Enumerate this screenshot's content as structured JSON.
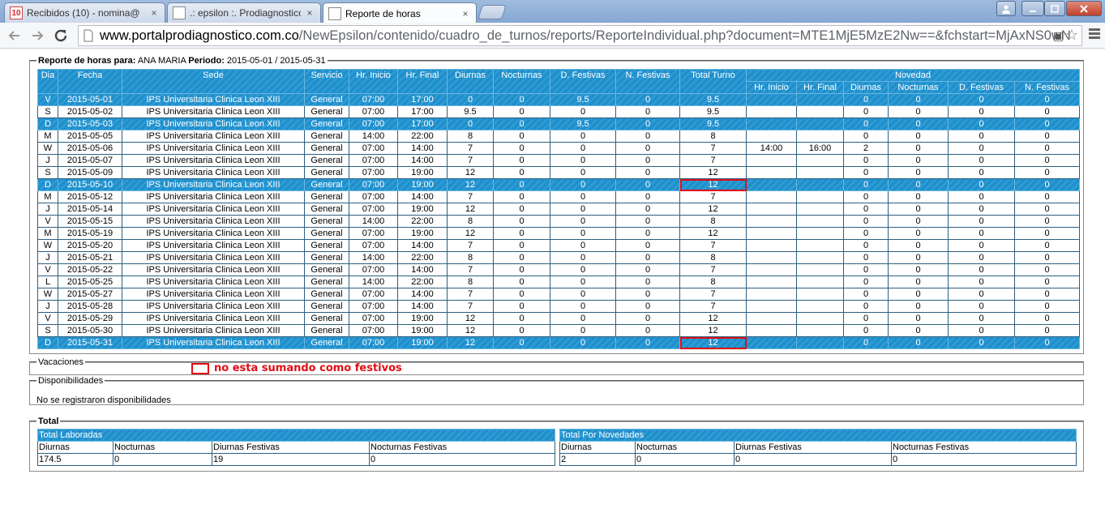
{
  "browser": {
    "tabs": [
      {
        "title": "Recibidos (10) - nomina@",
        "icon": "gmail-icon",
        "badge": "10"
      },
      {
        "title": ".: epsilon :. Prodiagnostico",
        "icon": "document-icon"
      },
      {
        "title": "Reporte de horas",
        "icon": "document-icon",
        "active": true
      }
    ],
    "close_glyph": "×",
    "url_host": "www.portalprodiagnostico.com.co",
    "url_path": "/NewEpsilon/contenido/cuadro_de_turnos/reports/ReporteIndividual.php?document=MTE1MjE5MzE2Nw==&fchstart=MjAxNS0wN"
  },
  "report": {
    "legend_label": "Reporte de horas para:",
    "employee": "ANA MARIA",
    "period_label": "Periodo:",
    "period": "2015-05-01 / 2015-05-31",
    "headers": [
      "Dia",
      "Fecha",
      "Sede",
      "Servicio",
      "Hr. Inicio",
      "Hr. Final",
      "Diurnas",
      "Nocturnas",
      "D. Festivas",
      "N. Festivas",
      "Total Turno",
      "Novedad"
    ],
    "novedad_headers": [
      "Hr. Inicio",
      "Hr. Final",
      "Diurnas",
      "Nocturnas",
      "D. Festivas",
      "N. Festivas"
    ],
    "rows": [
      {
        "style": "blue",
        "cells": [
          "V",
          "2015-05-01",
          "IPS Universitaria Clinica Leon XIII",
          "General",
          "07:00",
          "17:00",
          "0",
          "0",
          "9.5",
          "0",
          "9.5",
          "",
          "",
          "0",
          "0",
          "0",
          "0"
        ]
      },
      {
        "style": "white",
        "cells": [
          "S",
          "2015-05-02",
          "IPS Universitaria Clinica Leon XIII",
          "General",
          "07:00",
          "17:00",
          "9.5",
          "0",
          "0",
          "0",
          "9.5",
          "",
          "",
          "0",
          "0",
          "0",
          "0"
        ]
      },
      {
        "style": "blue",
        "cells": [
          "D",
          "2015-05-03",
          "IPS Universitaria Clinica Leon XIII",
          "General",
          "07:00",
          "17:00",
          "0",
          "0",
          "9.5",
          "0",
          "9.5",
          "",
          "",
          "0",
          "0",
          "0",
          "0"
        ]
      },
      {
        "style": "white",
        "cells": [
          "M",
          "2015-05-05",
          "IPS Universitaria Clinica Leon XIII",
          "General",
          "14:00",
          "22:00",
          "8",
          "0",
          "0",
          "0",
          "8",
          "",
          "",
          "0",
          "0",
          "0",
          "0"
        ]
      },
      {
        "style": "white",
        "cells": [
          "W",
          "2015-05-06",
          "IPS Universitaria Clinica Leon XIII",
          "General",
          "07:00",
          "14:00",
          "7",
          "0",
          "0",
          "0",
          "7",
          "14:00",
          "16:00",
          "2",
          "0",
          "0",
          "0"
        ]
      },
      {
        "style": "white",
        "cells": [
          "J",
          "2015-05-07",
          "IPS Universitaria Clinica Leon XIII",
          "General",
          "07:00",
          "14:00",
          "7",
          "0",
          "0",
          "0",
          "7",
          "",
          "",
          "0",
          "0",
          "0",
          "0"
        ]
      },
      {
        "style": "white",
        "cells": [
          "S",
          "2015-05-09",
          "IPS Universitaria Clinica Leon XIII",
          "General",
          "07:00",
          "19:00",
          "12",
          "0",
          "0",
          "0",
          "12",
          "",
          "",
          "0",
          "0",
          "0",
          "0"
        ]
      },
      {
        "style": "blue",
        "cells": [
          "D",
          "2015-05-10",
          "IPS Universitaria Clinica Leon XIII",
          "General",
          "07:00",
          "19:00",
          "12",
          "0",
          "0",
          "0",
          "12",
          "",
          "",
          "0",
          "0",
          "0",
          "0"
        ],
        "highlight_total": true
      },
      {
        "style": "white",
        "cells": [
          "M",
          "2015-05-12",
          "IPS Universitaria Clinica Leon XIII",
          "General",
          "07:00",
          "14:00",
          "7",
          "0",
          "0",
          "0",
          "7",
          "",
          "",
          "0",
          "0",
          "0",
          "0"
        ]
      },
      {
        "style": "white",
        "cells": [
          "J",
          "2015-05-14",
          "IPS Universitaria Clinica Leon XIII",
          "General",
          "07:00",
          "19:00",
          "12",
          "0",
          "0",
          "0",
          "12",
          "",
          "",
          "0",
          "0",
          "0",
          "0"
        ]
      },
      {
        "style": "white",
        "cells": [
          "V",
          "2015-05-15",
          "IPS Universitaria Clinica Leon XIII",
          "General",
          "14:00",
          "22:00",
          "8",
          "0",
          "0",
          "0",
          "8",
          "",
          "",
          "0",
          "0",
          "0",
          "0"
        ]
      },
      {
        "style": "white",
        "cells": [
          "M",
          "2015-05-19",
          "IPS Universitaria Clinica Leon XIII",
          "General",
          "07:00",
          "19:00",
          "12",
          "0",
          "0",
          "0",
          "12",
          "",
          "",
          "0",
          "0",
          "0",
          "0"
        ]
      },
      {
        "style": "white",
        "cells": [
          "W",
          "2015-05-20",
          "IPS Universitaria Clinica Leon XIII",
          "General",
          "07:00",
          "14:00",
          "7",
          "0",
          "0",
          "0",
          "7",
          "",
          "",
          "0",
          "0",
          "0",
          "0"
        ]
      },
      {
        "style": "white",
        "cells": [
          "J",
          "2015-05-21",
          "IPS Universitaria Clinica Leon XIII",
          "General",
          "14:00",
          "22:00",
          "8",
          "0",
          "0",
          "0",
          "8",
          "",
          "",
          "0",
          "0",
          "0",
          "0"
        ]
      },
      {
        "style": "white",
        "cells": [
          "V",
          "2015-05-22",
          "IPS Universitaria Clinica Leon XIII",
          "General",
          "07:00",
          "14:00",
          "7",
          "0",
          "0",
          "0",
          "7",
          "",
          "",
          "0",
          "0",
          "0",
          "0"
        ]
      },
      {
        "style": "white",
        "cells": [
          "L",
          "2015-05-25",
          "IPS Universitaria Clinica Leon XIII",
          "General",
          "14:00",
          "22:00",
          "8",
          "0",
          "0",
          "0",
          "8",
          "",
          "",
          "0",
          "0",
          "0",
          "0"
        ]
      },
      {
        "style": "white",
        "cells": [
          "W",
          "2015-05-27",
          "IPS Universitaria Clinica Leon XIII",
          "General",
          "07:00",
          "14:00",
          "7",
          "0",
          "0",
          "0",
          "7",
          "",
          "",
          "0",
          "0",
          "0",
          "0"
        ]
      },
      {
        "style": "white",
        "cells": [
          "J",
          "2015-05-28",
          "IPS Universitaria Clinica Leon XIII",
          "General",
          "07:00",
          "14:00",
          "7",
          "0",
          "0",
          "0",
          "7",
          "",
          "",
          "0",
          "0",
          "0",
          "0"
        ]
      },
      {
        "style": "white",
        "cells": [
          "V",
          "2015-05-29",
          "IPS Universitaria Clinica Leon XIII",
          "General",
          "07:00",
          "19:00",
          "12",
          "0",
          "0",
          "0",
          "12",
          "",
          "",
          "0",
          "0",
          "0",
          "0"
        ]
      },
      {
        "style": "white",
        "cells": [
          "S",
          "2015-05-30",
          "IPS Universitaria Clinica Leon XIII",
          "General",
          "07:00",
          "19:00",
          "12",
          "0",
          "0",
          "0",
          "12",
          "",
          "",
          "0",
          "0",
          "0",
          "0"
        ]
      },
      {
        "style": "blue",
        "cells": [
          "D",
          "2015-05-31",
          "IPS Universitaria Clinica Leon XIII",
          "General",
          "07:00",
          "19:00",
          "12",
          "0",
          "0",
          "0",
          "12",
          "",
          "",
          "0",
          "0",
          "0",
          "0"
        ],
        "highlight_total": true
      }
    ]
  },
  "annotation": {
    "text": "no esta sumando como festivos",
    "color": "#e10d14"
  },
  "vacaciones": {
    "legend": "Vacaciones"
  },
  "disponibilidades": {
    "legend": "Disponibilidades",
    "message": "No se registraron disponibilidades"
  },
  "total": {
    "legend": "Total",
    "laboradas": {
      "title": "Total Laboradas",
      "labels": [
        "Diurnas",
        "Nocturnas",
        "Diurnas Festivas",
        "Nocturnas Festivas"
      ],
      "values": [
        "174.5",
        "0",
        "19",
        "0"
      ]
    },
    "novedades": {
      "title": "Total Por Novedades",
      "labels": [
        "Diurnas",
        "Nocturnas",
        "Diurnas Festivas",
        "Nocturnas Festivas"
      ],
      "values": [
        "2",
        "0",
        "0",
        "0"
      ]
    }
  },
  "colors": {
    "header_blue": "#1f8ec9",
    "highlight_red": "#e10d14"
  }
}
